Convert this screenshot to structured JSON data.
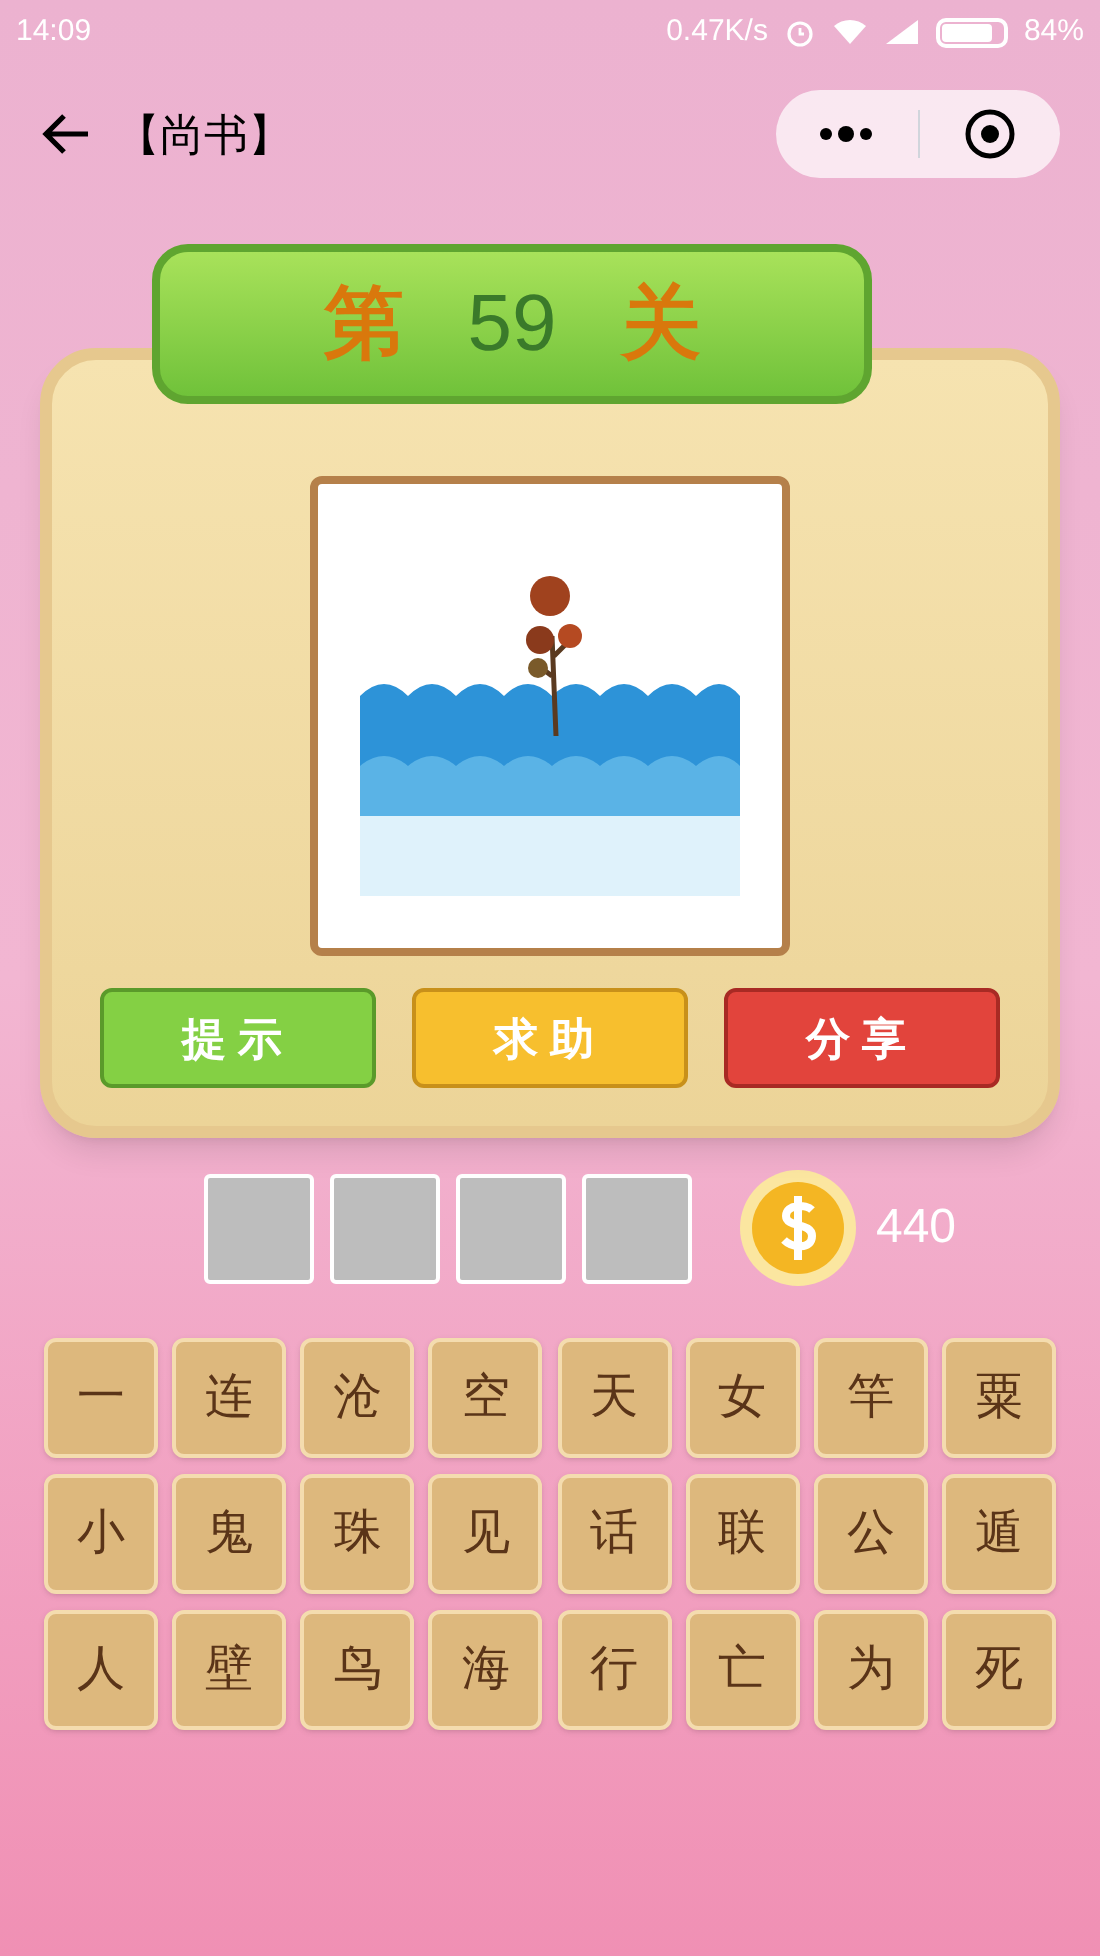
{
  "status_bar": {
    "time": "14:09",
    "speed": "0.47K/s",
    "battery": "84%"
  },
  "nav": {
    "title": "【尚书】"
  },
  "level": {
    "prefix": "第",
    "number": "59",
    "suffix": "关"
  },
  "buttons": [
    {
      "label": "提示",
      "kind": "hint"
    },
    {
      "label": "求助",
      "kind": "help"
    },
    {
      "label": "分享",
      "kind": "share"
    }
  ],
  "answer_slots": [
    {
      "filled": false
    },
    {
      "filled": false
    },
    {
      "filled": false
    },
    {
      "filled": false
    }
  ],
  "coins": "440",
  "letters": [
    [
      "一",
      "连",
      "沧",
      "空",
      "天",
      "女",
      "竿",
      "粟"
    ],
    [
      "小",
      "鬼",
      "珠",
      "见",
      "话",
      "联",
      "公",
      "遁"
    ],
    [
      "人",
      "壁",
      "鸟",
      "海",
      "行",
      "亡",
      "为",
      "死"
    ]
  ]
}
